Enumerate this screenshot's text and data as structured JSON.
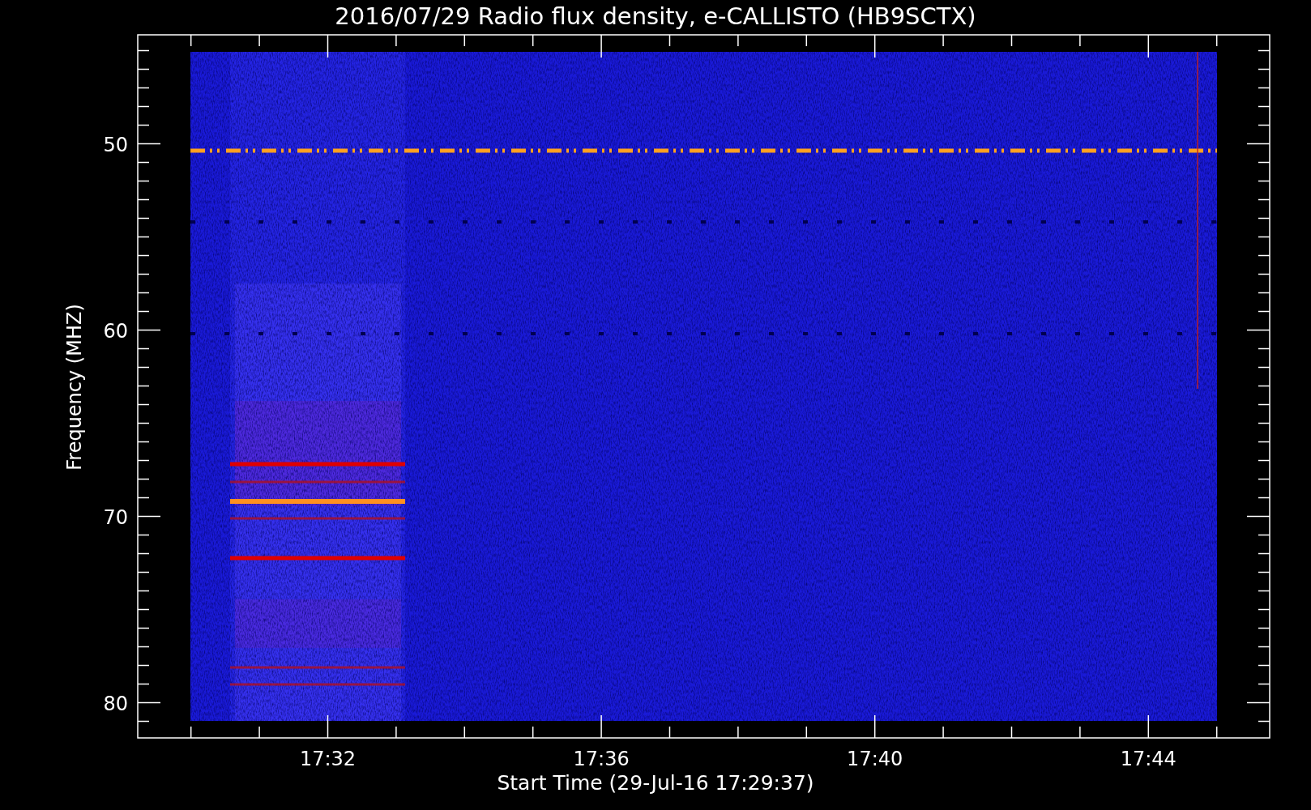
{
  "title": "2016/07/29  Radio flux density, e-CALLISTO (HB9SCTX)",
  "ylabel": "Frequency (MHZ)",
  "xlabel": "Start Time (29-Jul-16 17:29:37)",
  "yticks": [
    "50",
    "60",
    "70",
    "80"
  ],
  "xticks": [
    "17:32",
    "17:36",
    "17:40",
    "17:44"
  ]
}
